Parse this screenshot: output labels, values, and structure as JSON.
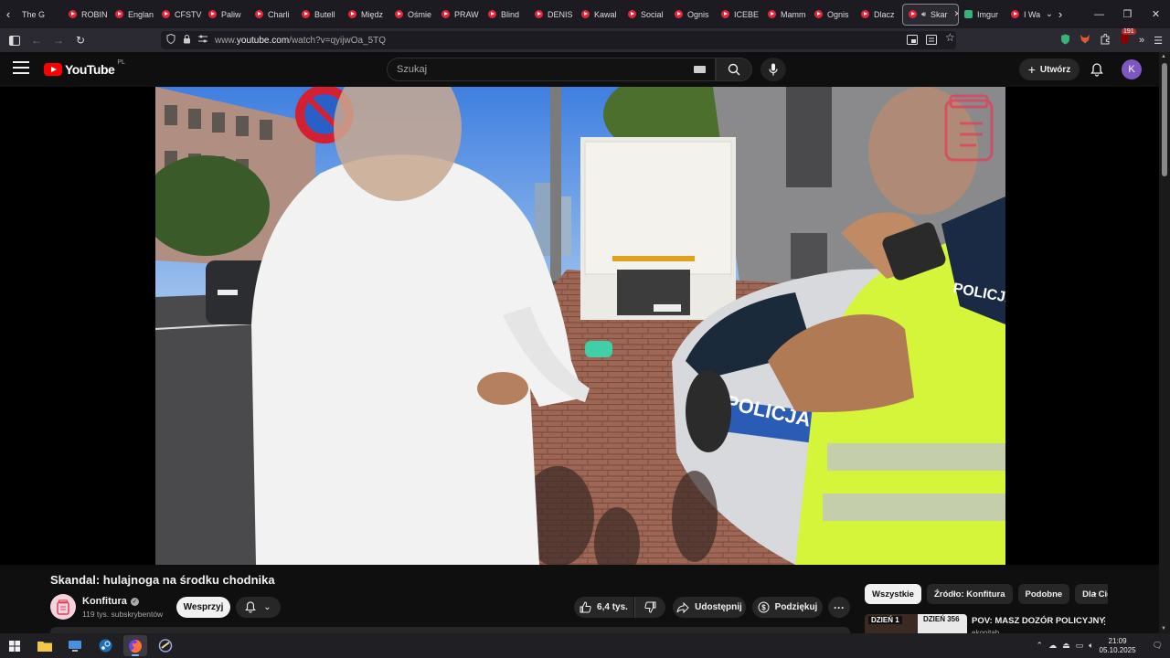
{
  "browser": {
    "tabs": [
      {
        "label": "The G",
        "type": "plain"
      },
      {
        "label": "ROBIN",
        "type": "yt"
      },
      {
        "label": "Englan",
        "type": "yt"
      },
      {
        "label": "CFSTV",
        "type": "yt"
      },
      {
        "label": "Paliw",
        "type": "yt"
      },
      {
        "label": "Charli",
        "type": "yt"
      },
      {
        "label": "Butell",
        "type": "yt"
      },
      {
        "label": "Międz",
        "type": "yt"
      },
      {
        "label": "Ośmie",
        "type": "yt"
      },
      {
        "label": "PRAW",
        "type": "yt"
      },
      {
        "label": "Blind ",
        "type": "yt"
      },
      {
        "label": "DENIS",
        "type": "yt"
      },
      {
        "label": "Kawal",
        "type": "yt"
      },
      {
        "label": "Social",
        "type": "yt"
      },
      {
        "label": "Ognis",
        "type": "yt"
      },
      {
        "label": "ICEBE",
        "type": "yt"
      },
      {
        "label": "Mamm",
        "type": "yt"
      },
      {
        "label": "Ognis",
        "type": "yt"
      },
      {
        "label": "Dlacz",
        "type": "yt"
      },
      {
        "label": "Skar",
        "type": "active"
      },
      {
        "label": "Imgur",
        "type": "green"
      },
      {
        "label": "I Wa",
        "type": "yt"
      }
    ],
    "url_prefix": "www.",
    "url_domain": "youtube.com",
    "url_path": "/watch?v=qyijwOa_5TQ",
    "extension_badge": "191"
  },
  "youtube": {
    "logo_text": "YouTube",
    "country_code": "PL",
    "search_placeholder": "Szukaj",
    "create_label": "Utwórz",
    "avatar_letter": "K"
  },
  "video": {
    "title": "Skandal: hulajnoga na środku chodnika",
    "channel_name": "Konfitura",
    "subscribers": "119 tys. subskrybentów",
    "support_label": "Wesprzyj",
    "likes": "6,4 tys.",
    "share_label": "Udostępnij",
    "thanks_label": "Podziękuj",
    "scene_text": "POLICJA",
    "vest_text": "POLICJA"
  },
  "sidebar": {
    "chips": [
      "Wszystkie",
      "Źródło: Konfitura",
      "Podobne",
      "Dla Ciebie"
    ],
    "recommendation": {
      "thumb_left": "DZIEŃ 1",
      "thumb_right": "DZIEŃ 356",
      "title": "POV: MASZ DOZÓR POLICYJNY",
      "channel": "ekonitab"
    }
  },
  "taskbar": {
    "time": "21:09",
    "date": "05.10.2025"
  },
  "colors": {
    "yt_red": "#ff0000",
    "bg": "#0f0f0f",
    "vest": "#d4f53a",
    "police_blue": "#2a5bb5"
  }
}
